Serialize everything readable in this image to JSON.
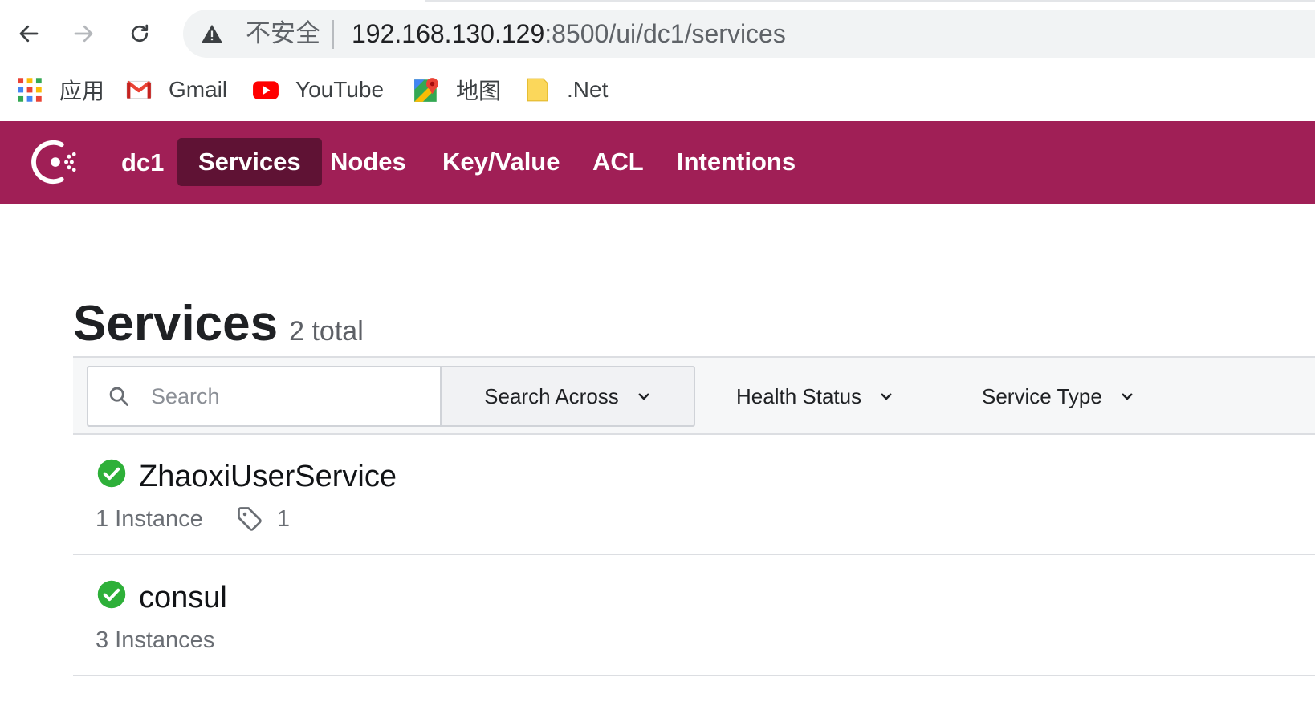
{
  "browser": {
    "insecure_label": "不安全",
    "url_host": "192.168.130.129",
    "url_path": ":8500/ui/dc1/services",
    "bookmarks": [
      {
        "label": "应用",
        "icon": "apps-grid-icon"
      },
      {
        "label": "Gmail",
        "icon": "gmail-icon"
      },
      {
        "label": "YouTube",
        "icon": "youtube-icon"
      },
      {
        "label": "地图",
        "icon": "maps-icon"
      },
      {
        "label": ".Net",
        "icon": "folder-icon"
      }
    ]
  },
  "topnav": {
    "datacenter": "dc1",
    "tabs": [
      {
        "label": "Services",
        "active": true
      },
      {
        "label": "Nodes",
        "active": false
      },
      {
        "label": "Key/Value",
        "active": false
      },
      {
        "label": "ACL",
        "active": false
      },
      {
        "label": "Intentions",
        "active": false
      }
    ]
  },
  "page": {
    "title": "Services",
    "count": "2 total"
  },
  "filters": {
    "search_placeholder": "Search",
    "search_value": "",
    "search_across": "Search Across",
    "health_status": "Health Status",
    "service_type": "Service Type"
  },
  "services": [
    {
      "name": "ZhaoxiUserService",
      "instances": "1 Instance",
      "tags": "1",
      "health": "passing"
    },
    {
      "name": "consul",
      "instances": "3 Instances",
      "health": "passing"
    }
  ],
  "colors": {
    "brand": "#a01f56",
    "brand_active": "#5f1234",
    "health_passing": "#2eb039"
  }
}
